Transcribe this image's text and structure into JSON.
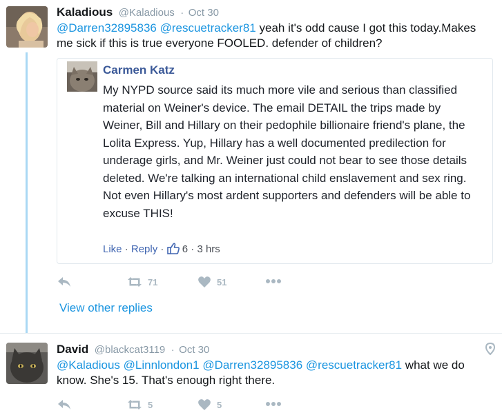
{
  "tweet1": {
    "name": "Kaladious",
    "handle": "@Kaladious",
    "separator": "·",
    "date": "Oct 30",
    "mentions": [
      "@Darren32895836",
      "@rescuetracker81"
    ],
    "text": "yeah it's odd cause I got this today.Makes me sick if this is true everyone FOOLED. defender of children?",
    "retweets": "71",
    "likes": "51"
  },
  "quote": {
    "name": "Carmen Katz",
    "text": "My NYPD source said its much more vile and serious than classified material on Weiner's device. The email DETAIL the trips made by Weiner, Bill and Hillary on their pedophile billionaire friend's plane, the Lolita Express. Yup, Hillary has a well documented predilection for underage girls, and Mr. Weiner just could not bear to see those details deleted. We're talking an international child enslavement and sex ring. Not even Hillary's most ardent supporters and defenders will be able to excuse THIS!",
    "like_label": "Like",
    "reply_label": "Reply",
    "dot": "·",
    "reaction_count": "6",
    "time": "3 hrs"
  },
  "view_other_replies": "View other replies",
  "tweet2": {
    "name": "David",
    "handle": "@blackcat3119",
    "separator": "·",
    "date": "Oct 30",
    "mentions": [
      "@Kaladious",
      "@Linnlondon1",
      "@Darren32895836",
      "@rescuetracker81"
    ],
    "text": "what we do know. She's 15. That's enough right there.",
    "retweets": "5",
    "likes": "5"
  },
  "colors": {
    "link_blue": "#1b95e0",
    "thread_line": "#aad8f4",
    "icon_gray": "#aab8c2",
    "facebook_name": "#3b5998"
  },
  "icons": [
    "reply-icon",
    "retweet-icon",
    "heart-icon",
    "more-icon",
    "location-pin-icon",
    "thumbs-up-icon"
  ]
}
